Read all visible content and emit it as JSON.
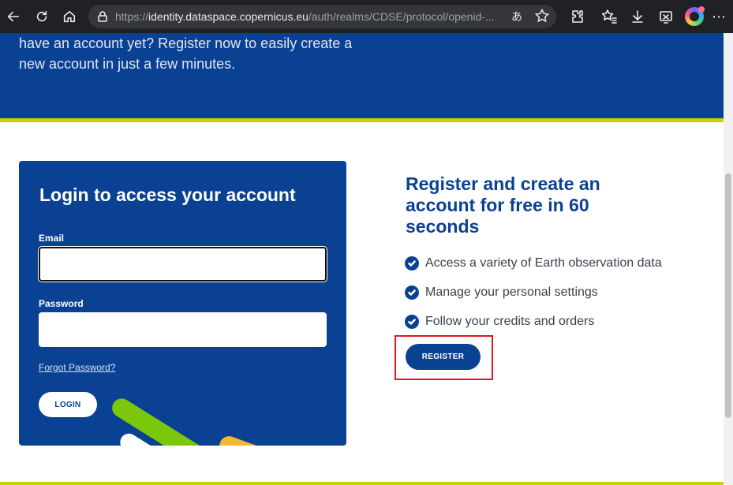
{
  "browser": {
    "url_prefix": "https://",
    "url_host": "identity.dataspace.copernicus.eu",
    "url_path": "/auth/realms/CDSE/protocol/openid-...",
    "read_aloud_glyph": "あ"
  },
  "hero": {
    "text": "have an account yet? Register now to easily create a new account in just a few minutes."
  },
  "login": {
    "title": "Login to access your account",
    "email_label": "Email",
    "email_value": "",
    "password_label": "Password",
    "password_value": "",
    "forgot_label": "Forgot Password?",
    "login_button": "LOGIN"
  },
  "register": {
    "title": "Register and create an account for free in 60 seconds",
    "benefits": [
      "Access a variety of Earth observation data",
      "Manage your personal settings",
      "Follow your credits and orders"
    ],
    "button": "REGISTER"
  },
  "colors": {
    "brand_blue": "#0b4193",
    "accent_lime": "#c6d300",
    "highlight_red": "#e3171e"
  }
}
